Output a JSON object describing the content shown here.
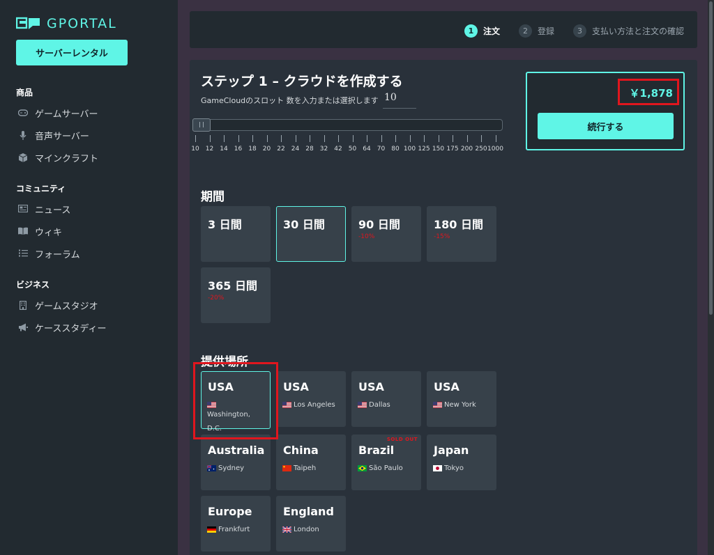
{
  "brand": {
    "name": "GPORTAL"
  },
  "sidebar": {
    "rent_button": "サーバーレンタル",
    "sections": [
      {
        "title": "商品",
        "items": [
          {
            "label": "ゲームサーバー",
            "icon": "gamepad-icon"
          },
          {
            "label": "音声サーバー",
            "icon": "microphone-icon"
          },
          {
            "label": "マインクラフト",
            "icon": "cube-icon"
          }
        ]
      },
      {
        "title": "コミュニティ",
        "items": [
          {
            "label": "ニュース",
            "icon": "newspaper-icon"
          },
          {
            "label": "ウィキ",
            "icon": "book-icon"
          },
          {
            "label": "フォーラム",
            "icon": "list-icon"
          }
        ]
      },
      {
        "title": "ビジネス",
        "items": [
          {
            "label": "ゲームスタジオ",
            "icon": "building-icon"
          },
          {
            "label": "ケーススタディー",
            "icon": "megaphone-icon"
          }
        ]
      }
    ]
  },
  "steps": [
    {
      "num": "1",
      "label": "注文",
      "active": true
    },
    {
      "num": "2",
      "label": "登録",
      "active": false
    },
    {
      "num": "3",
      "label": "支払い方法と注文の確認",
      "active": false
    }
  ],
  "config": {
    "title": "ステップ 1 – クラウドを作成する",
    "slot_label": "GameCloudのスロット 数を入力または選択します",
    "slot_value": "10",
    "slider_value": 10,
    "slider_ticks": [
      "10",
      "12",
      "14",
      "16",
      "18",
      "20",
      "22",
      "24",
      "28",
      "32",
      "42",
      "50",
      "64",
      "70",
      "80",
      "100",
      "125",
      "150",
      "175",
      "200",
      "250",
      "1000"
    ]
  },
  "price": {
    "amount": "￥1,878",
    "continue_label": "続行する"
  },
  "duration": {
    "title": "期間",
    "options": [
      {
        "label": "3 日間",
        "discount": "",
        "selected": false
      },
      {
        "label": "30 日間",
        "discount": "",
        "selected": true
      },
      {
        "label": "90 日間",
        "discount": "-10%",
        "selected": false
      },
      {
        "label": "180 日間",
        "discount": "-15%",
        "selected": false
      },
      {
        "label": "365 日間",
        "discount": "-20%",
        "selected": false
      }
    ]
  },
  "location": {
    "title": "提供場所",
    "options": [
      {
        "country": "USA",
        "city": "Washington, D.C.",
        "flag": "us-flag",
        "selected": true,
        "sold_out": ""
      },
      {
        "country": "USA",
        "city": "Los Angeles",
        "flag": "us-flag",
        "selected": false,
        "sold_out": ""
      },
      {
        "country": "USA",
        "city": "Dallas",
        "flag": "us-flag",
        "selected": false,
        "sold_out": ""
      },
      {
        "country": "USA",
        "city": "New York",
        "flag": "us-flag",
        "selected": false,
        "sold_out": ""
      },
      {
        "country": "Australia",
        "city": "Sydney",
        "flag": "au-flag",
        "selected": false,
        "sold_out": ""
      },
      {
        "country": "China",
        "city": "Taipeh",
        "flag": "cn-flag",
        "selected": false,
        "sold_out": ""
      },
      {
        "country": "Brazil",
        "city": "São Paulo",
        "flag": "br-flag",
        "selected": false,
        "sold_out": "SOLD OUT"
      },
      {
        "country": "Japan",
        "city": "Tokyo",
        "flag": "jp-flag",
        "selected": false,
        "sold_out": ""
      },
      {
        "country": "Europe",
        "city": "Frankfurt",
        "flag": "de-flag",
        "selected": false,
        "sold_out": ""
      },
      {
        "country": "England",
        "city": "London",
        "flag": "gb-flag",
        "selected": false,
        "sold_out": ""
      }
    ]
  },
  "colors": {
    "accent": "#5ff5e6",
    "highlight": "#e0161e",
    "panel": "#29313a",
    "sidebar": "#222a30"
  }
}
